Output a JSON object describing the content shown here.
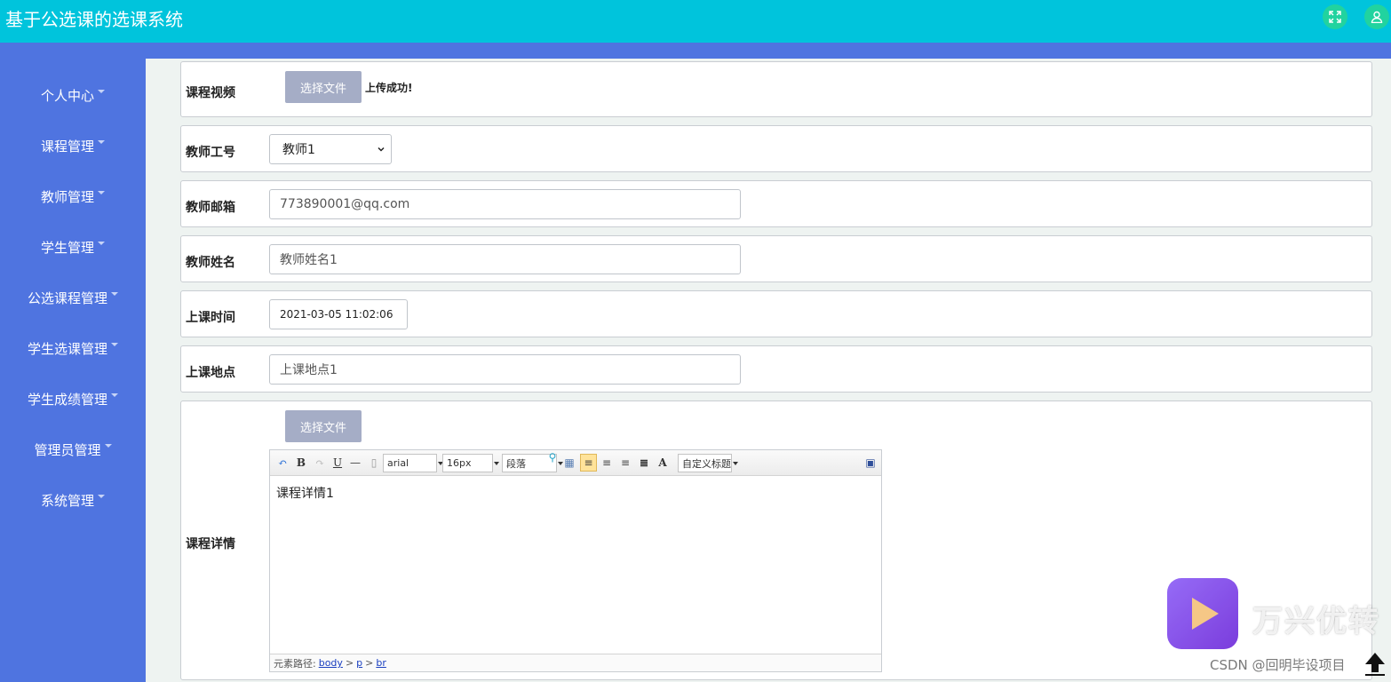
{
  "header": {
    "title": "基于公选课的选课系统",
    "fullscreen_icon": "fullscreen-icon",
    "user_icon": "user-icon",
    "accent": "#00c4dc"
  },
  "sidebar": {
    "bg": "#4f74e0",
    "items": [
      {
        "label": "个人中心"
      },
      {
        "label": "课程管理"
      },
      {
        "label": "教师管理"
      },
      {
        "label": "学生管理"
      },
      {
        "label": "公选课程管理"
      },
      {
        "label": "学生选课管理"
      },
      {
        "label": "学生成绩管理"
      },
      {
        "label": "管理员管理"
      },
      {
        "label": "系统管理"
      }
    ]
  },
  "form": {
    "video": {
      "label": "课程视频",
      "file_button": "选择文件",
      "status": "上传成功!"
    },
    "teacher_id": {
      "label": "教师工号",
      "selected": "教师1"
    },
    "teacher_email": {
      "label": "教师邮箱",
      "value": "773890001@qq.com"
    },
    "teacher_name": {
      "label": "教师姓名",
      "value": "教师姓名1"
    },
    "class_time": {
      "label": "上课时间",
      "value": "2021-03-05 11:02:06"
    },
    "class_place": {
      "label": "上课地点",
      "value": "上课地点1"
    },
    "details": {
      "label": "课程详情",
      "file_button": "选择文件",
      "toolbar": {
        "font_family": "arial",
        "font_size": "16px",
        "paragraph": "段落",
        "custom_title": "自定义标题"
      },
      "content": "课程详情1",
      "element_path_label": "元素路径:",
      "path": [
        "body",
        "p",
        "br"
      ],
      "path_sep": ">"
    }
  },
  "watermark": {
    "brand": "万兴优转",
    "credit": "CSDN @回明毕设项目"
  }
}
